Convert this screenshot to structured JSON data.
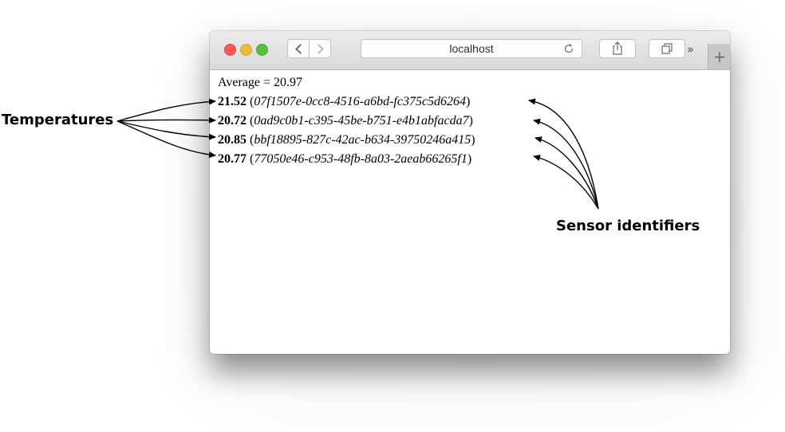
{
  "browser": {
    "address": "localhost",
    "more_glyph": "››",
    "new_tab_glyph": "+"
  },
  "page": {
    "average_label": "Average = 20.97",
    "readings": [
      {
        "temperature": "21.52",
        "sensor_id": "07f1507e-0cc8-4516-a6bd-fc375c5d6264"
      },
      {
        "temperature": "20.72",
        "sensor_id": "0ad9c0b1-c395-45be-b751-e4b1abfacda7"
      },
      {
        "temperature": "20.85",
        "sensor_id": "bbf18895-827c-42ac-b634-39750246a415"
      },
      {
        "temperature": "20.77",
        "sensor_id": "77050e46-c953-48fb-8a03-2aeab66265f1"
      }
    ]
  },
  "annotations": {
    "temperatures_label": "Temperatures",
    "sensor_label": "Sensor identifiers"
  },
  "colors": {
    "close": "#fc5b57",
    "minimize": "#e5bf3c",
    "maximize": "#57c038"
  }
}
